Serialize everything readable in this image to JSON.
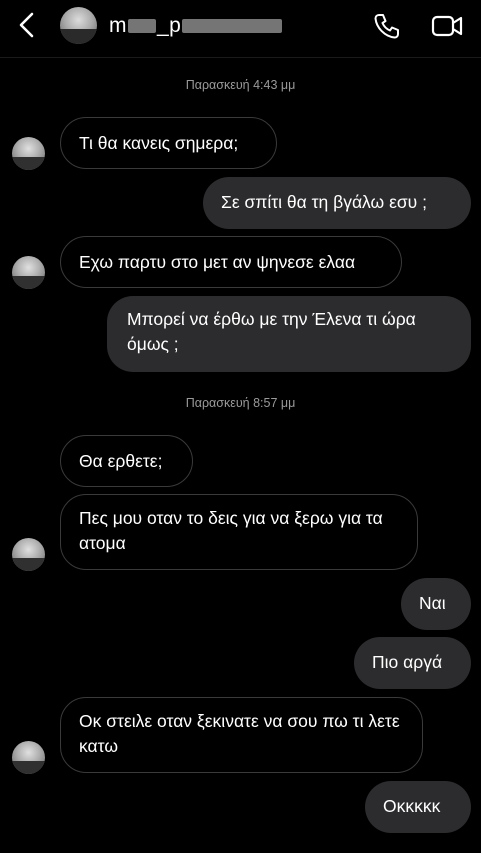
{
  "header": {
    "contact_name_start": "m",
    "contact_name_mid": "_p",
    "icons": [
      "back-arrow-icon",
      "phone-icon",
      "video-camera-icon"
    ]
  },
  "timestamps": [
    "Παρασκευή 4:43 μμ",
    "Παρασκευή 8:57 μμ"
  ],
  "messages": [
    {
      "text": "Τι θα κανεις σημερα;",
      "from": "them"
    },
    {
      "text": "Σε σπίτι θα τη βγάλω εσυ ;",
      "from": "me"
    },
    {
      "text": "Εχω παρτυ στο μετ αν ψηνεσε ελαα",
      "from": "them"
    },
    {
      "text": "Μπορεί να έρθω με την Έλενα τι ώρα όμως ;",
      "from": "me"
    },
    {
      "text": "Θα ερθετε;",
      "from": "them"
    },
    {
      "text": "Πες μου οταν το δεις για να ξερω για τα ατομα",
      "from": "them"
    },
    {
      "text": "Ναι",
      "from": "me"
    },
    {
      "text": "Πιο αργά",
      "from": "me"
    },
    {
      "text": "Οκ στειλε οταν ξεκινατε να σου πω τι λετε κατω",
      "from": "them"
    },
    {
      "text": "Οκκκκκ",
      "from": "me"
    }
  ],
  "colors": {
    "background": "#000000",
    "sent_bubble": "#2c2c2e",
    "received_border": "#3a3a3a",
    "timestamp": "#9a9a9a"
  }
}
